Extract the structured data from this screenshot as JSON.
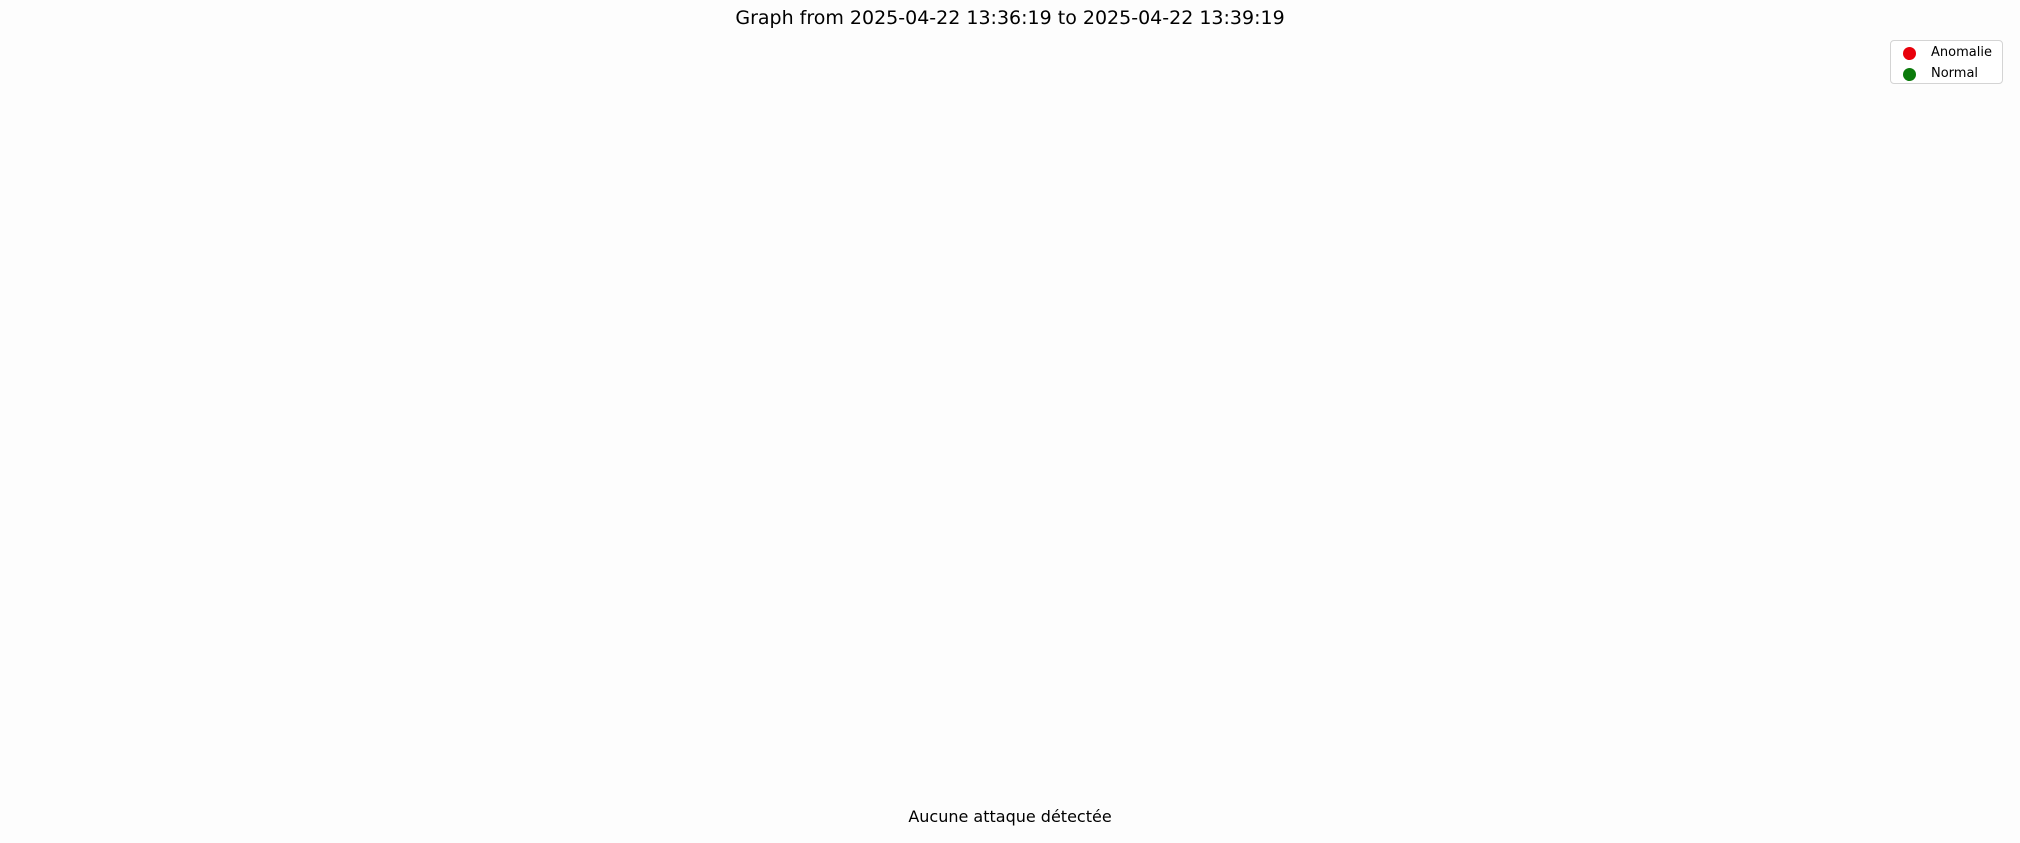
{
  "chart_data": {
    "type": "scatter",
    "title": "Graph from 2025-04-22 13:36:19 to 2025-04-22 13:39:19",
    "series": [
      {
        "name": "Anomalie",
        "color": "#e8000b",
        "points": []
      },
      {
        "name": "Normal",
        "color": "#0b7a0b",
        "points": []
      }
    ],
    "grid": false,
    "axes_visible": false,
    "legend_position": "top-right",
    "annotation": "Aucune attaque détectée"
  }
}
